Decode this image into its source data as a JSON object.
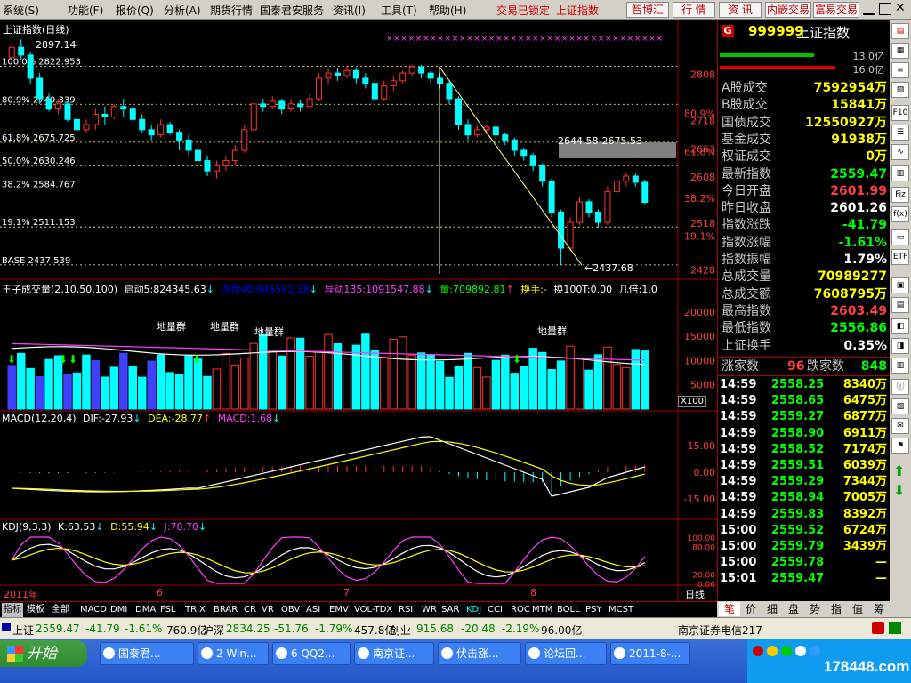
{
  "menu": [
    "系统(S)",
    "功能(F)",
    "报价(Q)",
    "分析(A)",
    "期货行情",
    "国泰君安服务",
    "资讯(I)",
    "工具(T)",
    "帮助(H)"
  ],
  "menu_status": "交易已锁定",
  "menu_index": "上证指数",
  "top_buttons": [
    "智博汇",
    "行 情",
    "资 讯",
    "内嵌交易",
    "富易交易"
  ],
  "chart_title": "上证指数(日线)",
  "price_panel": {
    "high_label": "2897.14",
    "fib_levels": [
      {
        "text": "100.0% 2822.953",
        "value": 2822.953
      },
      {
        "text": "80.9% 2749.339",
        "value": 2749.339
      },
      {
        "text": "61.8% 2675.725",
        "value": 2675.725
      },
      {
        "text": "50.0% 2630.246",
        "value": 2630.246
      },
      {
        "text": "38.2% 2584.767",
        "value": 2584.767
      },
      {
        "text": "19.1% 2511.153",
        "value": 2511.153
      },
      {
        "text": "BASE 2437.539",
        "value": 2437.539
      }
    ],
    "axis_ticks": [
      "2808",
      "2718",
      "2663",
      "2608",
      "2518",
      "2428"
    ],
    "axis_pcts": [
      "80.9%",
      "61.8%",
      "38.2%",
      "19.1%"
    ],
    "gap_label": "2644.58-2675.53",
    "low_label": "←2437.68",
    "ylim": [
      2420,
      2900
    ]
  },
  "volume_panel": {
    "header": {
      "name": "王子成交量(2,10,50,100)",
      "qd": "启动5:824345.63",
      "xp": "洗盘40:946582.38",
      "yd": "异动135:1091547.88",
      "vol": "量:709892.81",
      "hs": "换手:-",
      "hs100": "换100T:0.00",
      "jb": "几倍:1.0"
    },
    "labels": [
      "地量群",
      "地量群",
      "地量群",
      "地量群"
    ],
    "axis_ticks": [
      "20000",
      "15000",
      "10000",
      "5000"
    ],
    "unit": "X100"
  },
  "macd_panel": {
    "header": {
      "name": "MACD(12,20,4)",
      "dif": "DIF:-27.93",
      "dea": "DEA:-28.77",
      "macd": "MACD:1.68"
    },
    "axis_ticks": [
      "15.00",
      "0.00",
      "-15.00"
    ]
  },
  "kdj_panel": {
    "header": {
      "name": "KDJ(9,3,3)",
      "k": "K:63.53",
      "d": "D:55.94",
      "j": "J:78.70"
    },
    "axis_ticks": [
      "100.00",
      "80.00",
      "20.00",
      "0.00"
    ]
  },
  "date_axis": {
    "year": "2011年",
    "months": [
      "6",
      "7",
      "8"
    ],
    "period": "日线"
  },
  "indicator_tabs": [
    "指标",
    "模板",
    "全部",
    "MACD",
    "DMI",
    "DMA",
    "FSL",
    "TRIX",
    "BRAR",
    "CR",
    "VR",
    "OBV",
    "ASI",
    "EMV",
    "VOL-TDX",
    "RSI",
    "WR",
    "SAR",
    "KDJ",
    "CCI",
    "ROC",
    "MTM",
    "BOLL",
    "PSY",
    "MCST"
  ],
  "right_panel": {
    "code": "999999",
    "name": "上证指数",
    "bar_values": [
      "13.0亿",
      "16.0亿"
    ],
    "stats": [
      {
        "label": "A股成交",
        "value": "7592954万",
        "color": "#ffff00"
      },
      {
        "label": "B股成交",
        "value": "15841万",
        "color": "#ffff00"
      },
      {
        "label": "国债成交",
        "value": "12550927万",
        "color": "#ffff00"
      },
      {
        "label": "基金成交",
        "value": "91938万",
        "color": "#ffff00"
      },
      {
        "label": "权证成交",
        "value": "0万",
        "color": "#ffff00"
      },
      {
        "label": "最新指数",
        "value": "2559.47",
        "color": "#00ff00"
      },
      {
        "label": "今日开盘",
        "value": "2601.99",
        "color": "#ff4040"
      },
      {
        "label": "昨日收盘",
        "value": "2601.26",
        "color": "#ffffff"
      },
      {
        "label": "指数涨跌",
        "value": "-41.79",
        "color": "#00ff00"
      },
      {
        "label": "指数涨幅",
        "value": "-1.61%",
        "color": "#00ff00"
      },
      {
        "label": "指数振幅",
        "value": "1.79%",
        "color": "#ffffff"
      },
      {
        "label": "总成交量",
        "value": "70989277",
        "color": "#ffff00"
      },
      {
        "label": "总成交额",
        "value": "7608795万",
        "color": "#ffff00"
      },
      {
        "label": "最高指数",
        "value": "2603.49",
        "color": "#ff4040"
      },
      {
        "label": "最低指数",
        "value": "2556.86",
        "color": "#00ff00"
      },
      {
        "label": "上证换手",
        "value": "0.35%",
        "color": "#ffffff"
      }
    ],
    "rise_label": "涨家数",
    "rise_value": "96",
    "fall_label": "跌家数",
    "fall_value": "848",
    "ticks": [
      [
        "14:59",
        "2558.25",
        "8340万"
      ],
      [
        "14:59",
        "2558.65",
        "6475万"
      ],
      [
        "14:59",
        "2559.27",
        "6877万"
      ],
      [
        "14:59",
        "2558.90",
        "6911万"
      ],
      [
        "14:59",
        "2558.52",
        "7174万"
      ],
      [
        "14:59",
        "2559.51",
        "6039万"
      ],
      [
        "14:59",
        "2559.29",
        "7344万"
      ],
      [
        "14:59",
        "2558.94",
        "7005万"
      ],
      [
        "14:59",
        "2559.83",
        "8392万"
      ],
      [
        "15:00",
        "2559.52",
        "6724万"
      ],
      [
        "15:00",
        "2559.79",
        "3439万"
      ],
      [
        "15:00",
        "2559.78",
        "—"
      ],
      [
        "15:01",
        "2559.47",
        "—"
      ]
    ],
    "tabs": [
      "笔",
      "价",
      "细",
      "盘",
      "势",
      "指",
      "值",
      "筹"
    ]
  },
  "ticker": {
    "sh_name": "上证",
    "sh_val": "2559.47",
    "sh_chg": "-41.79",
    "sh_pct": "-1.61%",
    "sh_amt": "760.9亿",
    "sz_name": "沪深",
    "sz_val": "2834.25",
    "sz_chg": "-51.76",
    "sz_pct": "-1.79%",
    "sz_amt": "457.8亿",
    "cy_name": "创业",
    "cy_val": "915.68",
    "cy_chg": "-20.48",
    "cy_pct": "-2.19%",
    "cy_amt": "96.00亿",
    "broker": "南京证券电信217"
  },
  "taskbar": {
    "start": "开始",
    "buttons": [
      "国泰君...",
      "2 Win...",
      "6 QQ2...",
      "南京证...",
      "伏击涨...",
      "论坛回...",
      "2011-8-..."
    ],
    "watermark": "178448.com"
  },
  "tool_strip": [
    "F10",
    "Fiz",
    "f(x)",
    "ETF"
  ]
}
